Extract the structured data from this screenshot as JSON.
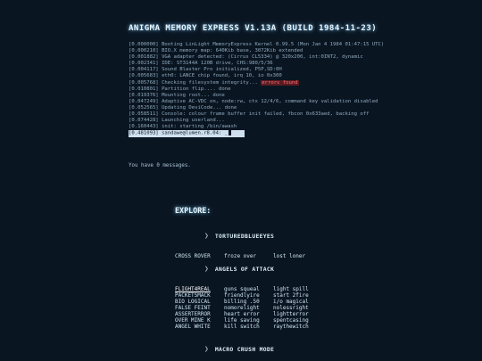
{
  "title": "ANIGMA MEMORY EXPRESS V1.13A (BUILD 1984-11-23)",
  "log": [
    {
      "time": "[0.000000]",
      "text": "Booting LinLight MemoryExpress Kernel 0.99.5 (Mon Jan 4 1984 01:47:15 UTC)"
    },
    {
      "time": "[0.000210]",
      "text": "BIO.X memory map: 640Kib base, 3072Kib extended"
    },
    {
      "time": "[0.001882]",
      "text": "VGA adapter detected: (Cirrus CL5334) @ 320x200, int:0INT2, dynamic"
    },
    {
      "time": "[0.002341]",
      "text": "IDE: ST3144A 120B drive, CHS:980/5/36"
    },
    {
      "time": "[0.004117]",
      "text": "Sound Blaster Pro initialized, P5P,SD:0H"
    },
    {
      "time": "[0.005683]",
      "text": "eth0: LANCE chip found, irq 10, io 0x300"
    },
    {
      "time": "[0.005768]",
      "text": "Checking filesystem integrity...",
      "error": "errors found"
    },
    {
      "time": "[0.010801]",
      "text": "Partition flip.... done"
    },
    {
      "time": "[0.019376]",
      "text": "Mounting root... done"
    },
    {
      "time": "[0.047249]",
      "text": "Adaptive AC-VDC on, node:rw, ctx 12/4/6, command key validation disabled"
    },
    {
      "time": "[0.052565]",
      "text": "Updating DeviCode... done"
    },
    {
      "time": "[0.058511]",
      "text": "Console: colour frame buffer init failed, fbcon 0x633aed, backing off"
    },
    {
      "time": "[0.074428]",
      "text": "Launching userland..."
    },
    {
      "time": "[0.160443]",
      "text": "init: starting /bin/awash"
    }
  ],
  "prompt": "[0.481093] sandawe@lumen.r8.04:",
  "prompt_cmd": " _",
  "messages": "You have 0 messages.",
  "explore": "EXPLORE:",
  "sections": [
    {
      "label": "〉 TORTUREDBLUEEYES",
      "rows": [
        [
          "CROSS ROVER",
          "froze over",
          "lost  loner"
        ]
      ]
    },
    {
      "label": "〉 ANGELS OF ATTACK",
      "rows": [
        [
          "FLIGHT4REAL",
          "guns squeal",
          "light spill"
        ],
        [
          "PACKETSMACK",
          "friendlyire",
          "start 2fire"
        ],
        [
          "BIO LOGICAL",
          "billing .50",
          "i/o magical"
        ],
        [
          "FALSE FEINT",
          "nomorelight",
          "nolessright"
        ],
        [
          "ASSERTERROR",
          "heart error",
          "lightterror"
        ],
        [
          "OVER MINE K",
          "life saving",
          "spentcasing"
        ],
        [
          "ANGEL WHITE",
          "kill switch",
          "raythewitch"
        ]
      ]
    },
    {
      "label": "〉 MACRO CRUSH MODE",
      "rows": []
    }
  ],
  "colors": {
    "background": "#0a1522",
    "error": "#ff6f6f",
    "accent": "#7fd0ff"
  }
}
